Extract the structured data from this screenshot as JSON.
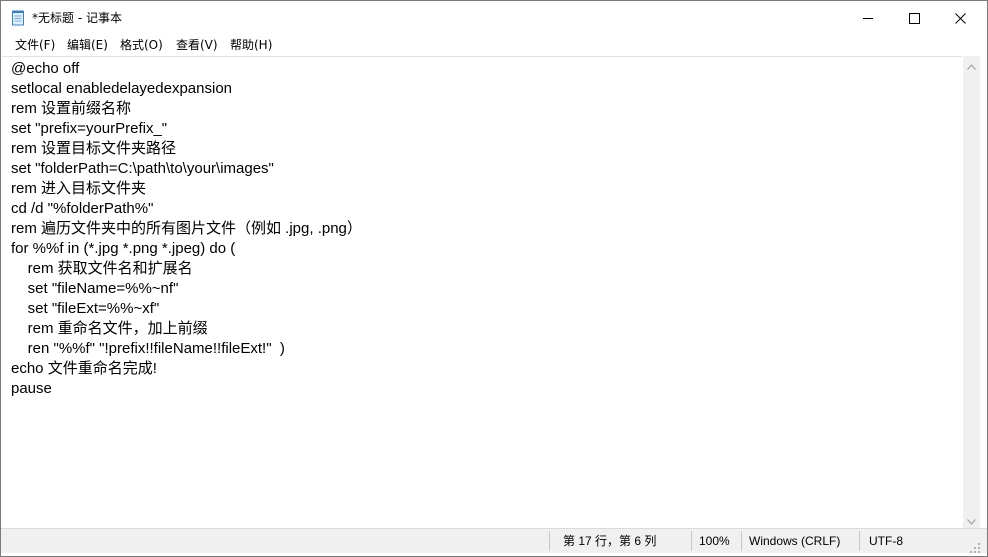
{
  "window": {
    "title": "*无标题 - 记事本"
  },
  "menu": {
    "items": [
      "文件(F)",
      "编辑(E)",
      "格式(O)",
      "查看(V)",
      "帮助(H)"
    ]
  },
  "editor": {
    "content": "@echo off\nsetlocal enabledelayedexpansion\nrem 设置前缀名称\nset \"prefix=yourPrefix_\"\nrem 设置目标文件夹路径\nset \"folderPath=C:\\path\\to\\your\\images\"\nrem 进入目标文件夹\ncd /d \"%folderPath%\"\nrem 遍历文件夹中的所有图片文件（例如 .jpg, .png）\nfor %%f in (*.jpg *.png *.jpeg) do (\n    rem 获取文件名和扩展名\n    set \"fileName=%%~nf\"\n    set \"fileExt=%%~xf\"\n    rem 重命名文件，加上前缀\n    ren \"%%f\" \"!prefix!!fileName!!fileExt!\"  )\necho 文件重命名完成!\npause"
  },
  "status": {
    "position": "第 17 行，第 6 列",
    "zoom": "100%",
    "line_ending": "Windows (CRLF)",
    "encoding": "UTF-8"
  },
  "icons": {
    "app": "notepad-icon",
    "minimize": "minimize-icon",
    "maximize": "maximize-icon",
    "close": "close-icon",
    "scroll_up": "chevron-up-icon",
    "scroll_down": "chevron-down-icon",
    "resize": "resize-grip-icon"
  }
}
